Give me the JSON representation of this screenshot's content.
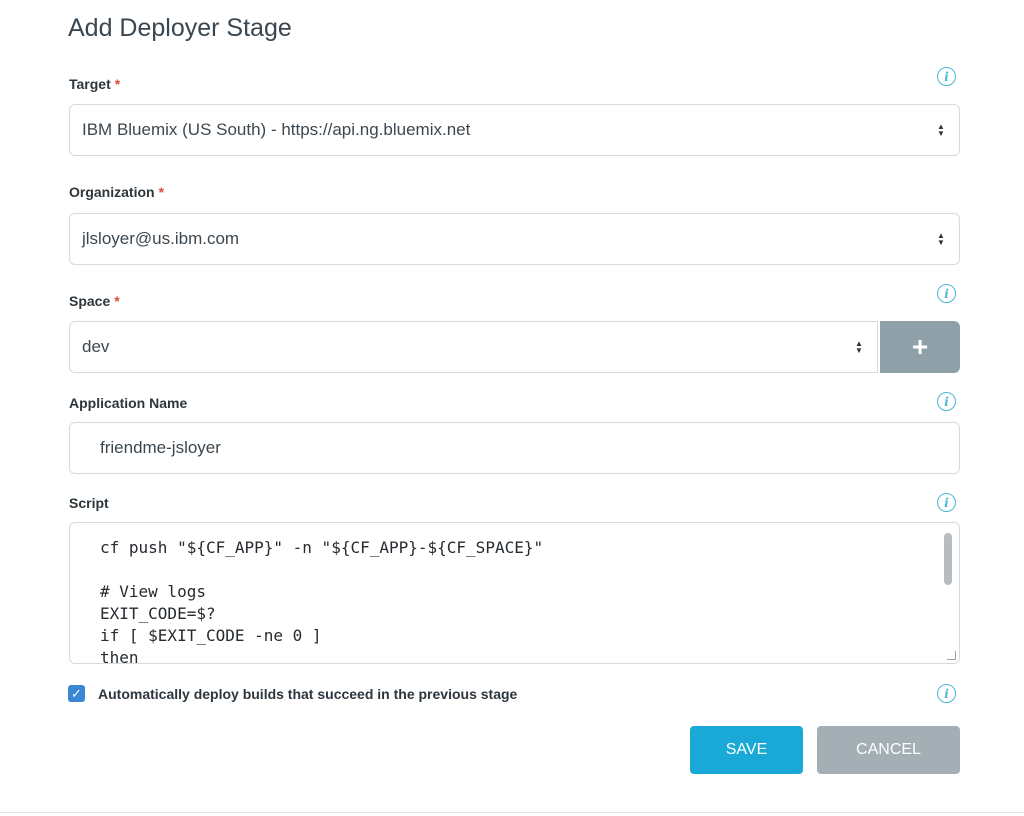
{
  "dialog": {
    "title": "Add Deployer Stage"
  },
  "fields": {
    "target": {
      "label": "Target",
      "required": "*",
      "value": "IBM Bluemix (US South) - https://api.ng.bluemix.net"
    },
    "organization": {
      "label": "Organization",
      "required": "*",
      "value": "jlsloyer@us.ibm.com"
    },
    "space": {
      "label": "Space",
      "required": "*",
      "value": "dev",
      "add_label": "+"
    },
    "application_name": {
      "label": "Application Name",
      "value": "friendme-jsloyer"
    },
    "script": {
      "label": "Script",
      "value": "cf push \"${CF_APP}\" -n \"${CF_APP}-${CF_SPACE}\"\n\n# View logs\nEXIT_CODE=$?\nif [ $EXIT_CODE -ne 0 ]\nthen"
    }
  },
  "auto_deploy": {
    "checked": true,
    "label": "Automatically deploy builds that succeed in the previous stage"
  },
  "buttons": {
    "save": "SAVE",
    "cancel": "CANCEL"
  },
  "icons": {
    "info": "info-icon",
    "select_arrows": "select-arrows-icon",
    "checkbox_check": "checkmark-icon"
  },
  "colors": {
    "accent": "#1aa9d6",
    "info": "#47b8d6",
    "required": "#e0493a",
    "checkbox": "#3a87d6",
    "secondary_button": "#a4afb5",
    "add_button": "#8fa0a8"
  }
}
